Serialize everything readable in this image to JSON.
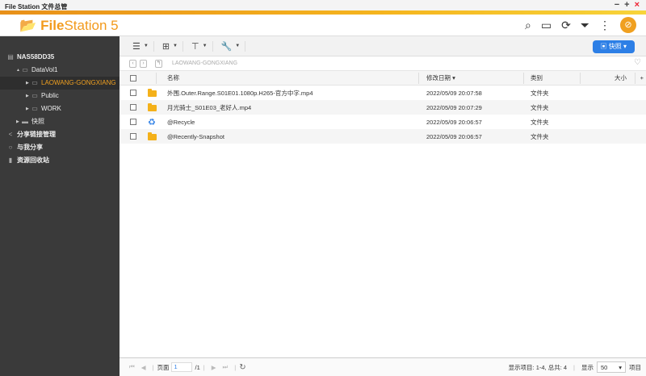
{
  "window": {
    "title": "File Station 文件总管",
    "minimize": "−",
    "maximize": "+",
    "close": "×"
  },
  "header": {
    "logo_bold": "File",
    "logo_rest": "Station 5"
  },
  "toolbar": {
    "snapshot_label": "快照"
  },
  "sidebar": {
    "items": [
      {
        "label": "NAS58DD35"
      },
      {
        "label": "DataVol1"
      },
      {
        "label": "LAOWANG-GONGXIANG"
      },
      {
        "label": "Public"
      },
      {
        "label": "WORK"
      },
      {
        "label": "快照"
      },
      {
        "label": "分享链接管理"
      },
      {
        "label": "与我分享"
      },
      {
        "label": "资源回收站"
      }
    ]
  },
  "path": {
    "current": "LAOWANG-GONGXIANG"
  },
  "columns": {
    "name": "名称",
    "date": "修改日期",
    "type": "类别",
    "size": "大小",
    "add": "+"
  },
  "files": [
    {
      "name": "外围.Outer.Range.S01E01.1080p.H265-官方中字.mp4",
      "date": "2022/05/09 20:07:58",
      "type": "文件夹",
      "icon": "folder"
    },
    {
      "name": "月光骑士_S01E03_老好人.mp4",
      "date": "2022/05/09 20:07:29",
      "type": "文件夹",
      "icon": "folder"
    },
    {
      "name": "@Recycle",
      "date": "2022/05/09 20:06:57",
      "type": "文件夹",
      "icon": "recycle"
    },
    {
      "name": "@Recently-Snapshot",
      "date": "2022/05/09 20:06:57",
      "type": "文件夹",
      "icon": "folder"
    }
  ],
  "footer": {
    "page_label": "页面",
    "page": "1",
    "page_total": "/1",
    "display_items": "显示项目: 1-4, 总共: 4",
    "show_label": "显示",
    "per_page": "50",
    "items_label": "项目"
  },
  "colors": {
    "accent": "#f29a1c",
    "primary": "#2d7fe6",
    "sidebar": "#3a3a3a"
  }
}
